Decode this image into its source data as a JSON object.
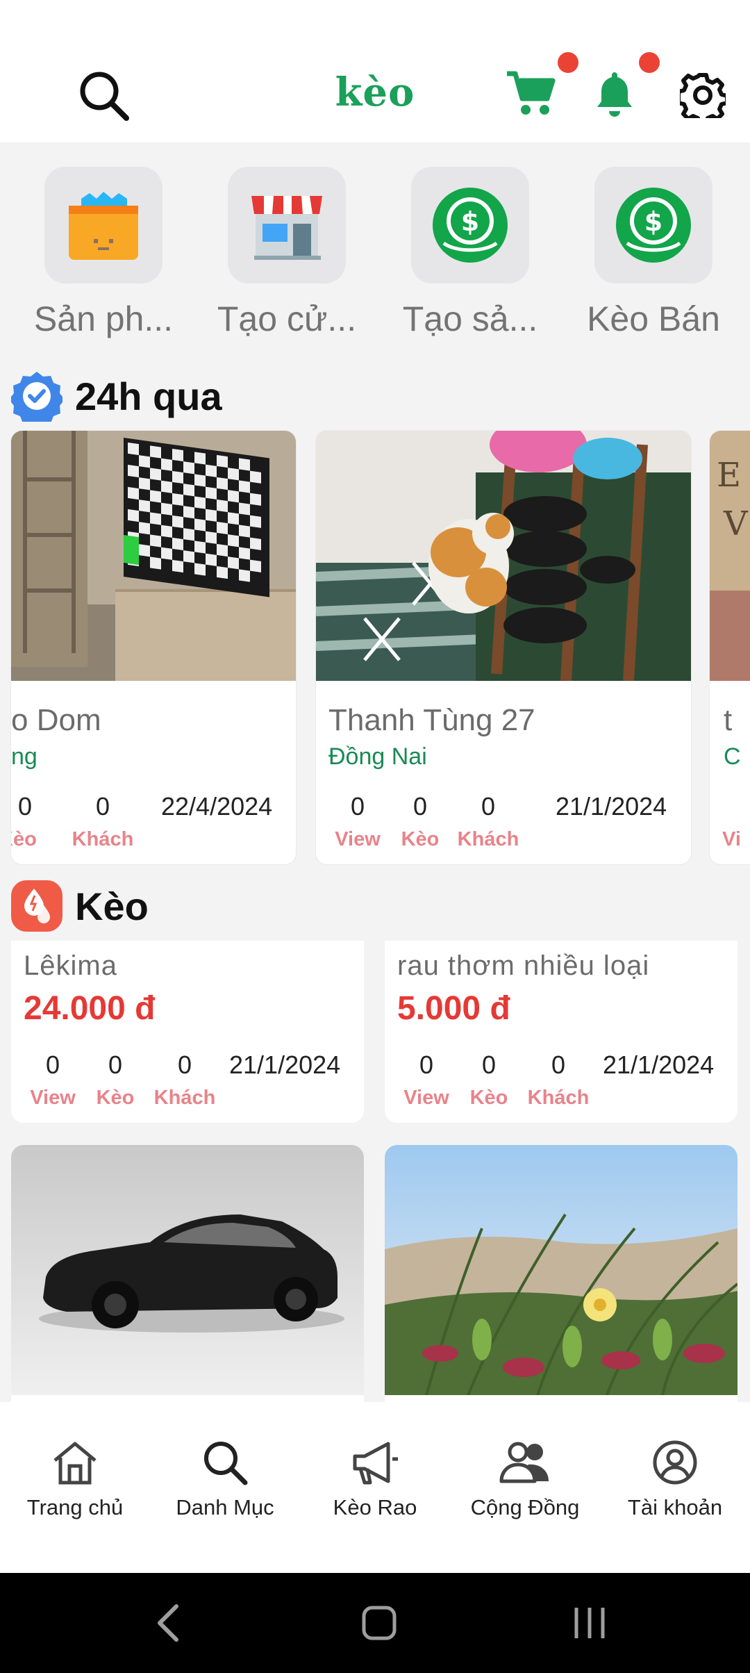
{
  "app": {
    "brand": "kèo"
  },
  "top_actions": {
    "cart_badge": true,
    "bell_badge": true,
    "colors": {
      "brand": "#1aa05a",
      "badge": "#ea4335"
    }
  },
  "quick_actions": [
    {
      "label": "Sản ph...",
      "icon": "box-icon"
    },
    {
      "label": "Tạo cử...",
      "icon": "store-icon"
    },
    {
      "label": "Tạo sả...",
      "icon": "dollar-coin-icon"
    },
    {
      "label": "Kèo Bán",
      "icon": "dollar-coin-icon"
    }
  ],
  "section_24h": {
    "title": "24h qua",
    "cards": [
      {
        "name": "o Dom",
        "location": "ng",
        "date": "22/4/2024",
        "stats": [
          {
            "value": "0",
            "label": "Kèo"
          },
          {
            "value": "0",
            "label": "Khách"
          }
        ]
      },
      {
        "name": "Thanh Tùng 27",
        "location": "Đồng Nai",
        "date": "21/1/2024",
        "stats": [
          {
            "value": "0",
            "label": "View"
          },
          {
            "value": "0",
            "label": "Kèo"
          },
          {
            "value": "0",
            "label": "Khách"
          }
        ]
      },
      {
        "name": "t",
        "location": "C",
        "label_partial": "Vi"
      }
    ]
  },
  "section_keo": {
    "title": "Kèo",
    "products": [
      {
        "name": "Lêkima",
        "price": "24.000 đ",
        "date": "21/1/2024",
        "stats": [
          {
            "value": "0",
            "label": "View"
          },
          {
            "value": "0",
            "label": "Kèo"
          },
          {
            "value": "0",
            "label": "Khách"
          }
        ]
      },
      {
        "name": "rau thơm nhiều loại",
        "price": "5.000 đ",
        "date": "21/1/2024",
        "stats": [
          {
            "value": "0",
            "label": "View"
          },
          {
            "value": "0",
            "label": "Kèo"
          },
          {
            "value": "0",
            "label": "Khách"
          }
        ]
      }
    ]
  },
  "bottom_nav": [
    {
      "label": "Trang chủ",
      "icon": "home-icon"
    },
    {
      "label": "Danh Mục",
      "icon": "search-icon"
    },
    {
      "label": "Kèo Rao",
      "icon": "megaphone-icon"
    },
    {
      "label": "Cộng Đồng",
      "icon": "people-icon"
    },
    {
      "label": "Tài khoản",
      "icon": "account-icon"
    }
  ]
}
